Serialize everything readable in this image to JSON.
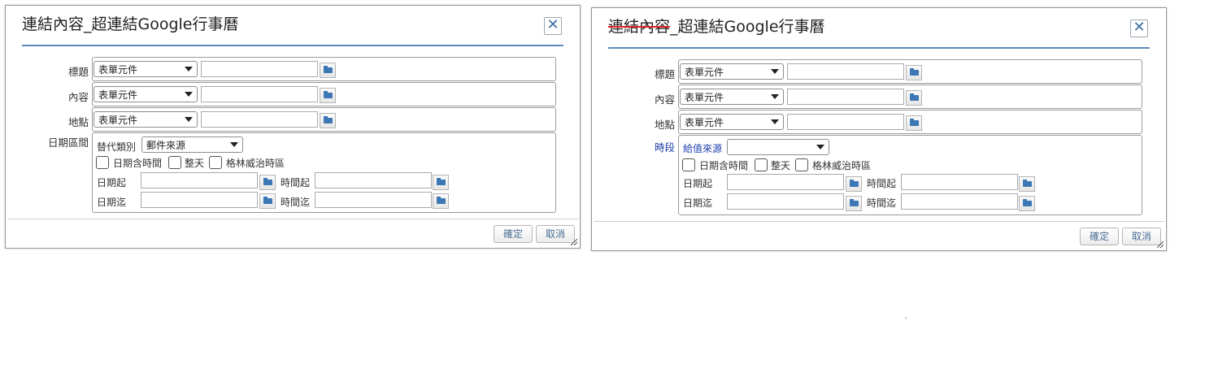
{
  "dialog_left": {
    "title": "連結內容_超連結Google行事曆",
    "labels": {
      "title": "標題",
      "content": "內容",
      "location": "地點",
      "date_range": "日期區間"
    },
    "select_value": "表單元件",
    "alt_type_label": "替代類別",
    "alt_type_value": "郵件來源",
    "check_time": "日期含時間",
    "check_allday": "整天",
    "check_gmt": "格林威治時區",
    "date_start": "日期起",
    "time_start": "時間起",
    "date_end": "日期迄",
    "time_end": "時間迄",
    "ok": "確定",
    "cancel": "取消"
  },
  "dialog_right": {
    "title_struck": "連結內容",
    "title_rest": "_超連結Google行事曆",
    "labels": {
      "title": "標題",
      "content": "內容",
      "location": "地點",
      "period": "時段"
    },
    "select_value": "表單元件",
    "value_source_label": "給值來源",
    "value_source_value": "",
    "check_time": "日期含時間",
    "check_allday": "整天",
    "check_gmt": "格林威治時區",
    "date_start": "日期起",
    "time_start": "時間起",
    "date_end": "日期迄",
    "time_end": "時間迄",
    "ok": "確定",
    "cancel": "取消"
  },
  "stray_mark": "`"
}
